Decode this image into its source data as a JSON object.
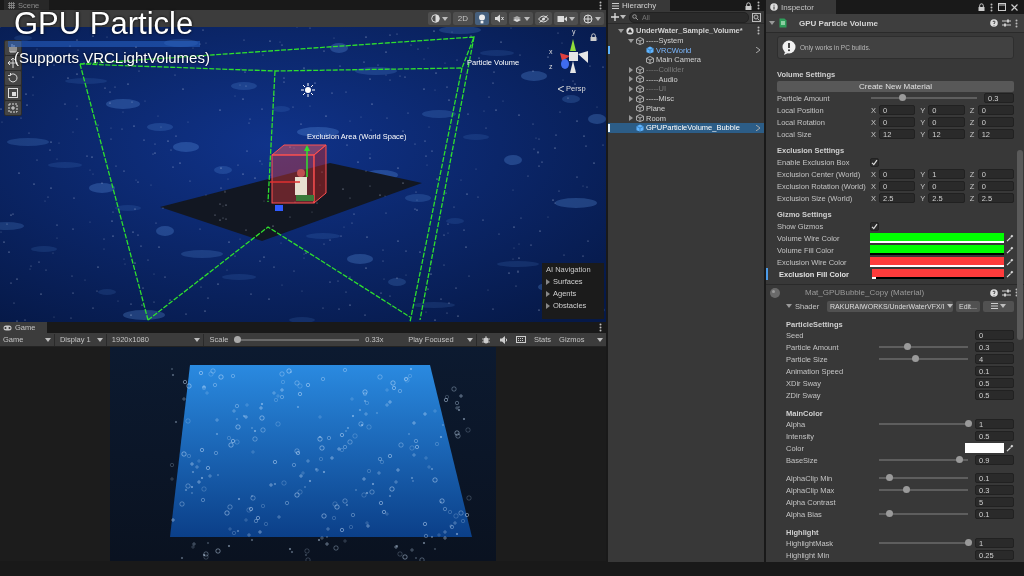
{
  "overlay": {
    "title": "GPU Particle",
    "subtitle": "(Supports VRCLightVolumes)"
  },
  "scene": {
    "tab": "Scene",
    "toolbar": {
      "mode_2d": {
        "label": "2D",
        "on": false
      },
      "lighting": {
        "on": true
      }
    },
    "labels": {
      "volume": "Particle Volume",
      "exclusion": "Exclusion Area (World Space)",
      "projection": "Persp"
    },
    "gizmo_axes": [
      "y",
      "x",
      "z"
    ],
    "ai_navigation": {
      "title": "AI Navigation",
      "items": [
        "Surfaces",
        "Agents",
        "Obstacles"
      ]
    }
  },
  "game": {
    "tab": "Game",
    "view": "Game",
    "display": "Display 1",
    "resolution": "1920x1080",
    "scale_label": "Scale",
    "scale": {
      "level": 0.02
    },
    "scale_value": "0.33x",
    "play_mode": "Play Focused",
    "stats": "Stats",
    "gizmos": "Gizmos"
  },
  "hierarchy": {
    "tab": "Hierarchy",
    "search": {
      "placeholder": "All"
    },
    "items": [
      {
        "label": "UnderWater_Sample_Volume*",
        "kind": "scene",
        "expanded": true,
        "active": true,
        "selected": false,
        "children": [
          {
            "label": "-----System",
            "kind": "object",
            "expanded": true,
            "active": true,
            "selected": false,
            "children": [
              {
                "label": "VRCWorld",
                "kind": "prefab",
                "active": true,
                "selected": false
              },
              {
                "label": "Main Camera",
                "kind": "object",
                "active": true,
                "selected": false
              }
            ]
          },
          {
            "label": "-----Collider",
            "kind": "object",
            "expanded": false,
            "active": false,
            "selected": false
          },
          {
            "label": "-----Audio",
            "kind": "object",
            "expanded": false,
            "active": true,
            "selected": false
          },
          {
            "label": "-----UI",
            "kind": "object",
            "expanded": false,
            "active": false,
            "selected": false
          },
          {
            "label": "-----Misc",
            "kind": "object",
            "expanded": false,
            "active": true,
            "selected": false
          },
          {
            "label": "Plane",
            "kind": "object",
            "active": true,
            "selected": false
          },
          {
            "label": "Room",
            "kind": "object",
            "expanded": false,
            "active": true,
            "selected": false
          },
          {
            "label": "GPUParticleVolume_Bubble",
            "kind": "prefab",
            "active": true,
            "selected": true
          }
        ]
      }
    ]
  },
  "inspector": {
    "tab": "Inspector",
    "component": {
      "title": "GPU Particle Volume",
      "expanded": true,
      "help": "Only works in PC builds.",
      "sections": [
        {
          "title": "Volume Settings",
          "rows": [
            {
              "kind": "button",
              "label": "Create New Material"
            },
            {
              "kind": "slider",
              "label": "Particle Amount",
              "level": 0.3,
              "value": "0.3"
            },
            {
              "kind": "vector",
              "label": "Local Position",
              "axes": [
                {
                  "axis": "X",
                  "value": "0"
                },
                {
                  "axis": "Y",
                  "value": "0"
                },
                {
                  "axis": "Z",
                  "value": "0"
                }
              ]
            },
            {
              "kind": "vector",
              "label": "Local Rotation",
              "axes": [
                {
                  "axis": "X",
                  "value": "0"
                },
                {
                  "axis": "Y",
                  "value": "0"
                },
                {
                  "axis": "Z",
                  "value": "0"
                }
              ]
            },
            {
              "kind": "vector",
              "label": "Local Size",
              "axes": [
                {
                  "axis": "X",
                  "value": "12"
                },
                {
                  "axis": "Y",
                  "value": "12"
                },
                {
                  "axis": "Z",
                  "value": "12"
                }
              ]
            }
          ]
        },
        {
          "title": "Exclusion Settings",
          "rows": [
            {
              "kind": "toggle",
              "label": "Enable Exclusion Box",
              "checked": true
            },
            {
              "kind": "vector",
              "label": "Exclusion Center (World)",
              "axes": [
                {
                  "axis": "X",
                  "value": "0"
                },
                {
                  "axis": "Y",
                  "value": "1"
                },
                {
                  "axis": "Z",
                  "value": "0"
                }
              ]
            },
            {
              "kind": "vector",
              "label": "Exclusion Rotation (World)",
              "axes": [
                {
                  "axis": "X",
                  "value": "0"
                },
                {
                  "axis": "Y",
                  "value": "0"
                },
                {
                  "axis": "Z",
                  "value": "0"
                }
              ]
            },
            {
              "kind": "vector",
              "label": "Exclusion Size (World)",
              "axes": [
                {
                  "axis": "X",
                  "value": "2.5"
                },
                {
                  "axis": "Y",
                  "value": "2.5"
                },
                {
                  "axis": "Z",
                  "value": "2.5"
                }
              ]
            }
          ]
        },
        {
          "title": "Gizmo Settings",
          "rows": [
            {
              "kind": "toggle",
              "label": "Show Gizmos",
              "checked": true,
              "modified": false
            },
            {
              "kind": "color",
              "label": "Volume Wire Color",
              "color": "#00ff00",
              "level": 1,
              "modified": false
            },
            {
              "kind": "color",
              "label": "Volume Fill Color",
              "color": "#00ff00",
              "level": 0,
              "modified": false
            },
            {
              "kind": "color",
              "label": "Exclusion Wire Color",
              "color": "#ff3b3b",
              "level": 1,
              "modified": false
            },
            {
              "kind": "color",
              "label": "Exclusion Fill Color",
              "color": "#ff3b3b",
              "level": 0.03,
              "modified": true
            }
          ]
        }
      ]
    },
    "material": {
      "title": "Mat_GPUBubble_Copy (Material)",
      "expanded": true,
      "shader_label": "Shader",
      "shader": "RAKURAIWORKS/UnderWaterVFX/I",
      "edit": "Edit...",
      "groups": [
        {
          "title": "ParticleSettings",
          "rows": [
            {
              "kind": "number",
              "label": "Seed",
              "value": "0"
            },
            {
              "kind": "slider",
              "label": "Particle Amount",
              "level": 0.32,
              "value": "0.3"
            },
            {
              "kind": "slider",
              "label": "Particle Size",
              "level": 0.41,
              "value": "4"
            },
            {
              "kind": "number",
              "label": "Animation Speed",
              "value": "0.1"
            },
            {
              "kind": "number",
              "label": "XDir Sway",
              "value": "0.5"
            },
            {
              "kind": "number",
              "label": "ZDir Sway",
              "value": "0.5"
            }
          ]
        },
        {
          "title": "MainColor",
          "rows": [
            {
              "kind": "slider",
              "label": "Alpha",
              "level": 1,
              "value": "1"
            },
            {
              "kind": "number",
              "label": "Intensity",
              "value": "0.5"
            },
            {
              "kind": "color",
              "label": "Color",
              "color": "#ffffff"
            },
            {
              "kind": "slider",
              "label": "BaseSize",
              "level": 0.9,
              "value": "0.9"
            }
          ]
        },
        {
          "rows": [
            {
              "kind": "slider",
              "label": "AlphaClip Min",
              "level": 0.12,
              "value": "0.1"
            },
            {
              "kind": "slider",
              "label": "AlphaClip Max",
              "level": 0.31,
              "value": "0.3"
            },
            {
              "kind": "number",
              "label": "Alpha Contrast",
              "value": "5"
            },
            {
              "kind": "slider",
              "label": "Alpha Bias",
              "level": 0.12,
              "value": "0.1"
            }
          ]
        },
        {
          "title": "Highlight",
          "rows": [
            {
              "kind": "slider",
              "label": "HighlightMask",
              "level": 1,
              "value": "1"
            },
            {
              "kind": "number",
              "label": "Highlight Min",
              "value": "0.25"
            }
          ]
        }
      ]
    }
  }
}
